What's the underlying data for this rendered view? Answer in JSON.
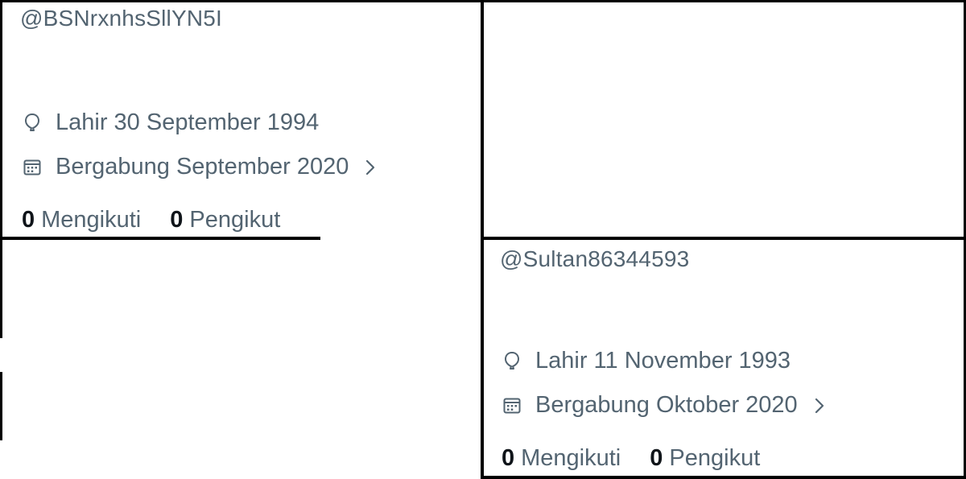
{
  "colors": {
    "text_secondary": "#536471",
    "text_primary": "#0f1419",
    "divider": "#000000",
    "background": "#ffffff"
  },
  "profiles": [
    {
      "handle": "@BSNrxnhsSllYN5I",
      "birth_icon": "balloon-icon",
      "birth_text": "Lahir 30 September 1994",
      "joined_icon": "calendar-icon",
      "joined_text": "Bergabung September 2020",
      "following_count": "0",
      "following_label": "Mengikuti",
      "followers_count": "0",
      "followers_label": "Pengikut"
    },
    {
      "handle": "@Sultan86344593",
      "birth_icon": "balloon-icon",
      "birth_text": "Lahir 11 November 1993",
      "joined_icon": "calendar-icon",
      "joined_text": "Bergabung Oktober 2020",
      "following_count": "0",
      "following_label": "Mengikuti",
      "followers_count": "0",
      "followers_label": "Pengikut"
    }
  ]
}
